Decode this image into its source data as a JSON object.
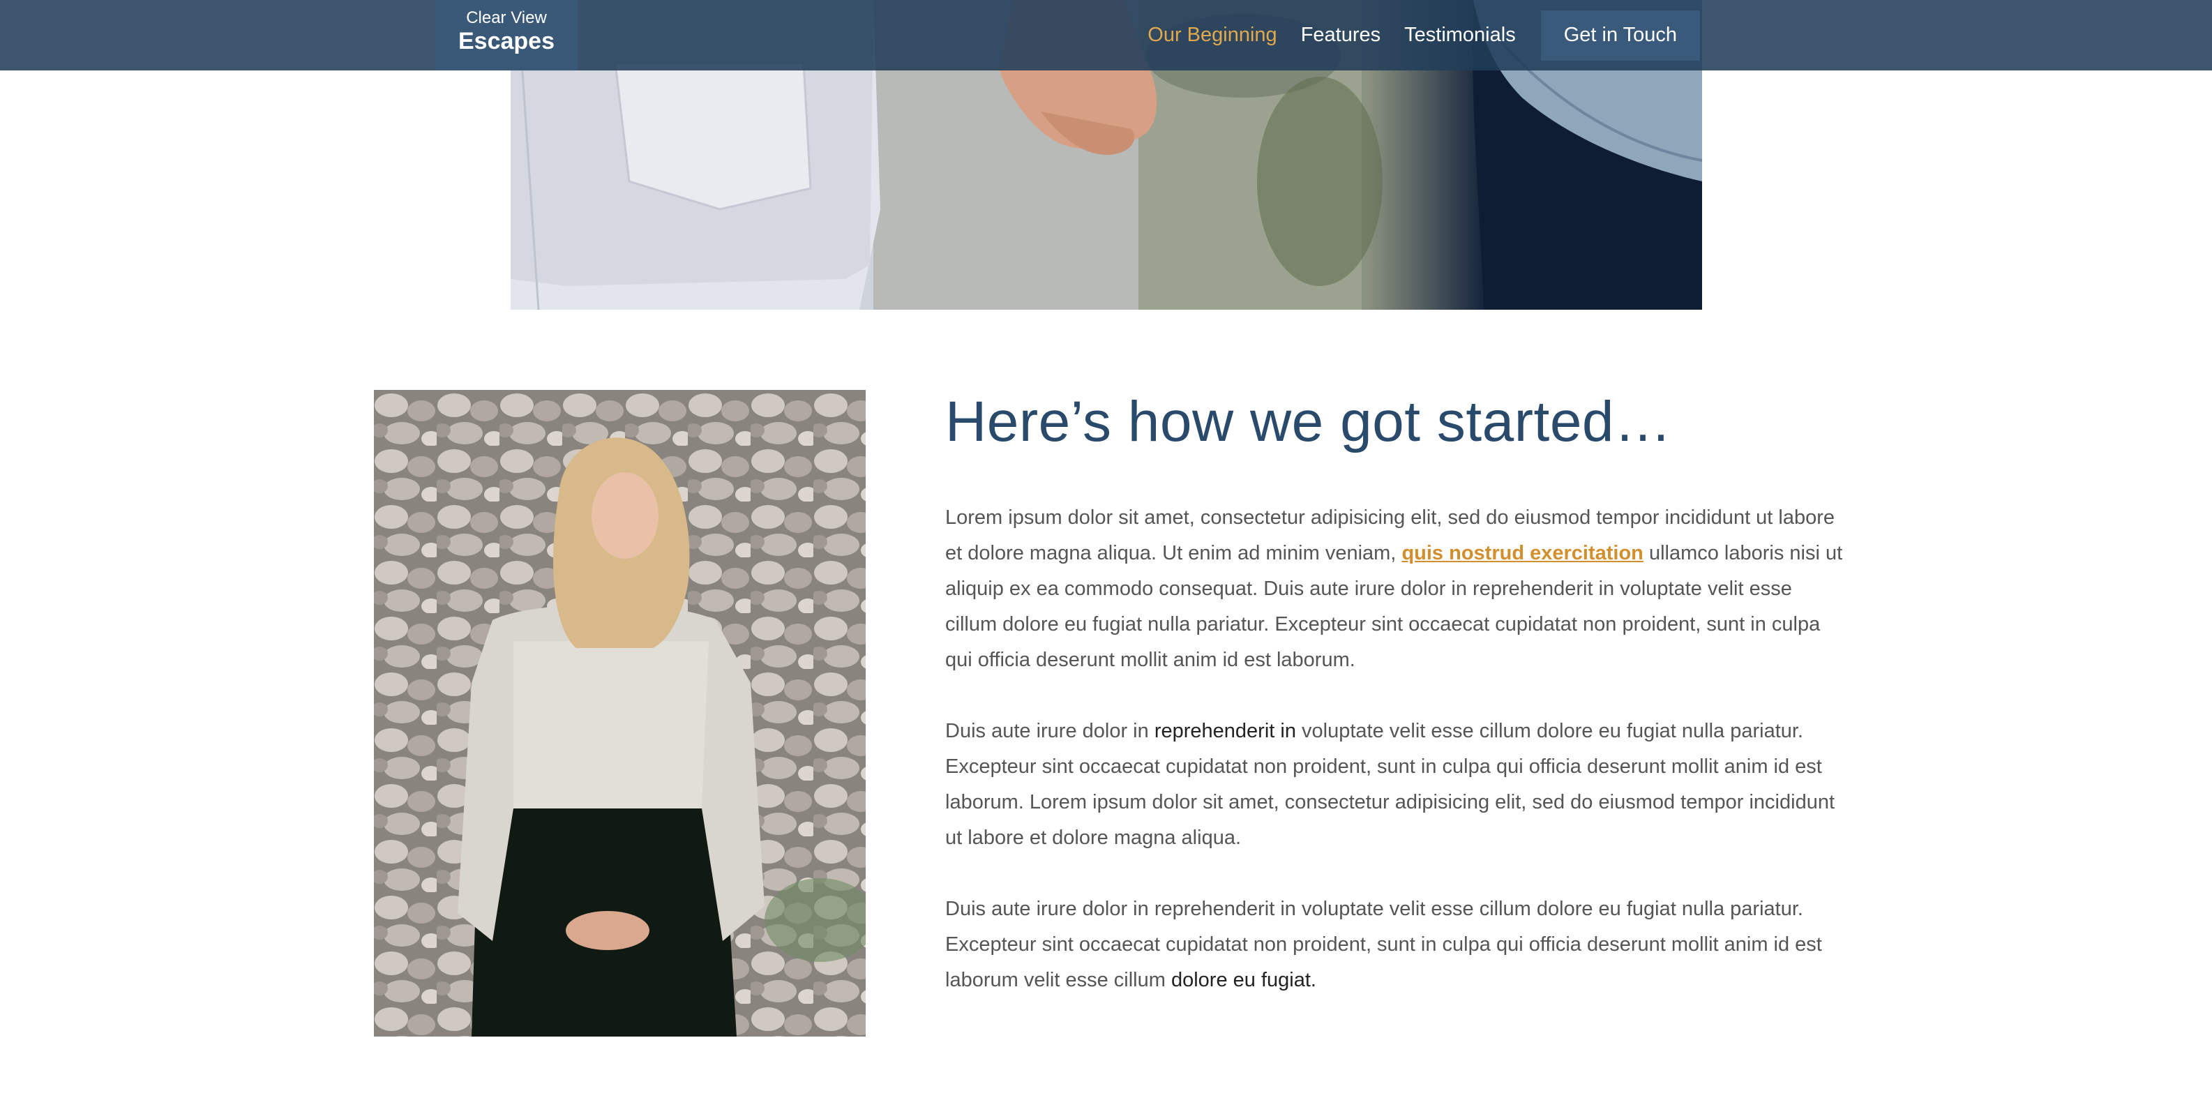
{
  "brand": {
    "name_top": "Clear View",
    "name_main": "Escapes"
  },
  "nav": {
    "items": [
      {
        "label": "Our Beginning",
        "active": true
      },
      {
        "label": "Features",
        "active": false
      },
      {
        "label": "Testimonials",
        "active": false
      }
    ],
    "cta_label": "Get in Touch"
  },
  "colors": {
    "nav_background": "#223e5a",
    "accent": "#e2a84e",
    "heading": "#2a4a6c",
    "link": "#d38f2d"
  },
  "hero_image": {
    "icon": "couple-holding-hands-photo"
  },
  "portrait_image": {
    "icon": "woman-in-sweater-photo"
  },
  "main": {
    "heading": "Here’s how we got started…",
    "p1": {
      "before": "Lorem ipsum dolor sit amet, consectetur adipisicing elit, sed do eiusmod tempor incididunt ut labore et dolore magna aliqua. Ut enim ad minim veniam, ",
      "link": "quis nostrud exercitation",
      "after": " ullamco laboris nisi ut aliquip ex ea commodo consequat. Duis aute irure dolor in reprehenderit in voluptate velit esse cillum dolore eu fugiat nulla pariatur. Excepteur sint occaecat cupidatat non proident, sunt in culpa qui officia deserunt mollit anim id est laborum."
    },
    "p2": {
      "before": "Duis aute irure dolor in ",
      "strong": "reprehenderit in",
      "after": " voluptate velit esse cillum dolore eu fugiat nulla pariatur. Excepteur sint occaecat cupidatat non proident, sunt in culpa qui officia deserunt mollit anim id est laborum. Lorem ipsum dolor sit amet, consectetur adipisicing elit, sed do eiusmod tempor incididunt ut labore et dolore magna aliqua."
    },
    "p3": {
      "before": "Duis aute irure dolor in reprehenderit in voluptate velit esse cillum dolore eu fugiat nulla pariatur. Excepteur sint occaecat cupidatat non proident, sunt in culpa qui officia deserunt mollit anim id est laborum velit esse cillum ",
      "strong": "dolore eu fugiat."
    }
  }
}
